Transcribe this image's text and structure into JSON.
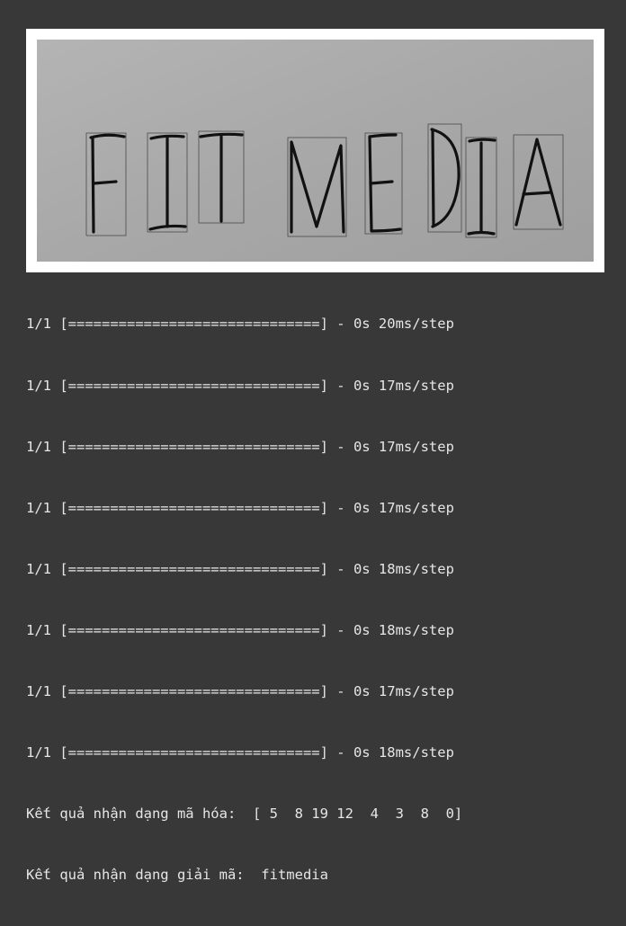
{
  "image": {
    "letters": [
      "F",
      "I",
      "T",
      "M",
      "E",
      "D",
      "I",
      "A"
    ]
  },
  "console": {
    "progress_lines": [
      "1/1 [==============================] - 0s 20ms/step",
      "1/1 [==============================] - 0s 17ms/step",
      "1/1 [==============================] - 0s 17ms/step",
      "1/1 [==============================] - 0s 17ms/step",
      "1/1 [==============================] - 0s 18ms/step",
      "1/1 [==============================] - 0s 18ms/step",
      "1/1 [==============================] - 0s 17ms/step",
      "1/1 [==============================] - 0s 18ms/step"
    ],
    "encoded_result": "Kết quả nhận dạng mã hóa:  [ 5  8 19 12  4  3  8  0]",
    "decoded_result": "Kết quả nhận dạng giải mã:  fitmedia"
  },
  "colors": {
    "background": "#383838",
    "frame": "#ffffff",
    "paper": "#a9a9a9",
    "ink": "#111111",
    "box": "#4a4a4a",
    "text": "#e6e6e6"
  }
}
